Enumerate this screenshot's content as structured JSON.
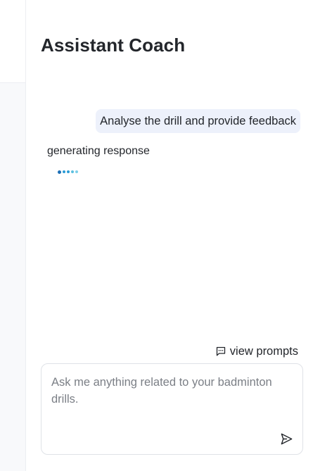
{
  "coach": {
    "title": "Assistant Coach",
    "messages": [
      {
        "role": "user",
        "text": "Analyse the drill and provide feedback"
      },
      {
        "role": "assistant",
        "status": "generating response"
      }
    ],
    "view_prompts_label": "view prompts",
    "input": {
      "value": "",
      "placeholder": "Ask me anything related to your badminton drills."
    },
    "icons": {
      "prompts": "message-square-icon",
      "send": "send-icon"
    }
  },
  "colors": {
    "user_bubble": "#edf1fb",
    "typing_dots": [
      "#1c6fb6",
      "#2a9bd6",
      "#2a9bd6",
      "#5cc0df",
      "#7ed0ea"
    ]
  }
}
